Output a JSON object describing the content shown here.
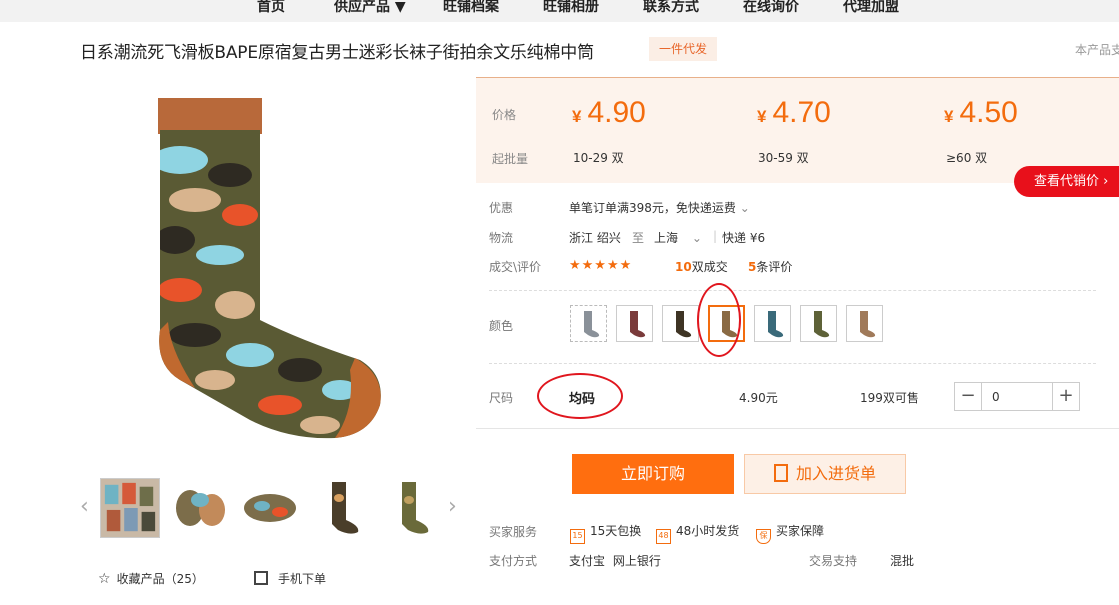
{
  "nav": {
    "items": [
      "首页",
      "供应产品 ▼",
      "旺铺档案",
      "旺铺相册",
      "联系方式",
      "在线询价",
      "代理加盟"
    ]
  },
  "product": {
    "title": "日系潮流死飞滑板BAPE原宿复古男士迷彩长袜子街拍余文乐纯棉中筒",
    "dropship_badge": "一件代发",
    "right_note": "本产品支"
  },
  "gallery": {
    "prev": "‹",
    "next": "›",
    "favorite_label": "收藏产品（25）",
    "mobile_label": "手机下单"
  },
  "pricing": {
    "price_label": "价格",
    "moq_label": "起批量",
    "currency": "¥",
    "tiers": [
      {
        "price": "4.90",
        "range": "10-29 双"
      },
      {
        "price": "4.70",
        "range": "30-59 双"
      },
      {
        "price": "4.50",
        "range": "≥60 双"
      }
    ],
    "agent_button": "查看代销价 ›"
  },
  "info": {
    "promo_label": "优惠",
    "promo_value": "单笔订单满398元，免快递运费",
    "logistics_label": "物流",
    "origin": "浙江 绍兴",
    "to": "至",
    "destination": "上海",
    "shipping": "快递 ¥6",
    "reviews_label": "成交\\评价",
    "stars": "★★★★★",
    "deals_count": "10",
    "deals_text": "双成交",
    "review_count": "5",
    "review_text": "条评价"
  },
  "options": {
    "color_label": "颜色",
    "size_label": "尺码",
    "size_value": "均码",
    "unit_price": "4.90元",
    "stock": "199双可售",
    "qty": "0"
  },
  "actions": {
    "buy": "立即订购",
    "cart": "加入进货单"
  },
  "services": {
    "buyer_label": "买家服务",
    "items": [
      {
        "icon": "15",
        "text": "15天包换"
      },
      {
        "icon": "48",
        "text": "48小时发货"
      },
      {
        "icon": "保",
        "text": "买家保障"
      }
    ],
    "payment_label": "支付方式",
    "payment_methods": "支付宝  网上银行",
    "trade_label": "交易支持",
    "trade_value": "混批"
  },
  "colors": {
    "accent": "#f36c0e",
    "red": "#e8101b",
    "price_bg": "#fdf3ec"
  }
}
